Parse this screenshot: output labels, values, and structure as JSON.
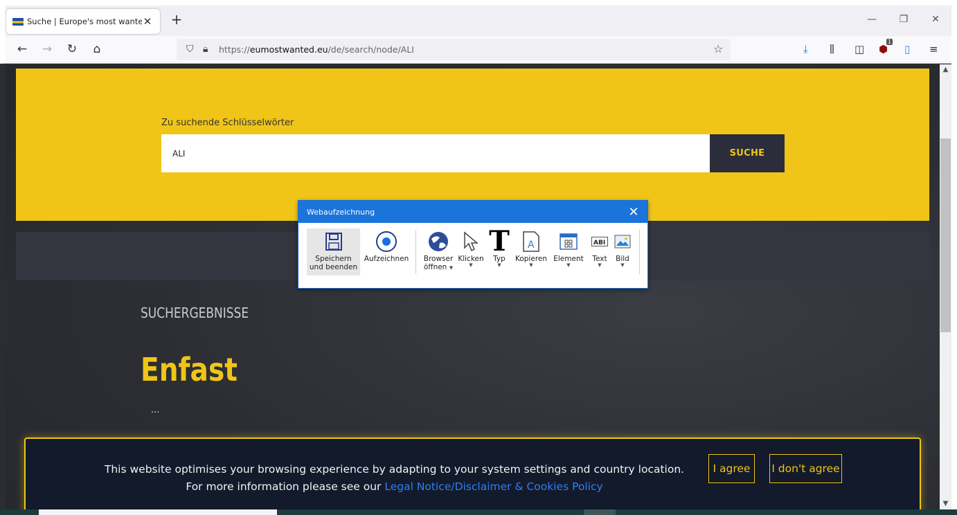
{
  "browser": {
    "tab_title": "Suche | Europe's most wanted",
    "url_scheme": "https://",
    "url_host": "eumostwanted.eu",
    "url_path": "/de/search/node/ALI",
    "ublock_badge": "1"
  },
  "search": {
    "label": "Zu suchende Schlüsselwörter",
    "value": "ALI",
    "button_label": "SUCHE"
  },
  "results": {
    "heading": "SUCHERGEBNISSE",
    "items": [
      {
        "title": "Enfast",
        "snippet": "..."
      }
    ]
  },
  "recorder": {
    "title": "Webaufzeichnung",
    "tools": [
      {
        "line1": "Speichern",
        "line2": "und beenden",
        "icon": "floppy-disk-icon"
      },
      {
        "line1": "Aufzeichnen",
        "line2": "",
        "icon": "record-icon"
      },
      {
        "line1": "Browser",
        "line2": "öffnen",
        "icon": "globe-icon"
      },
      {
        "line1": "Klicken",
        "line2": "",
        "icon": "cursor-icon"
      },
      {
        "line1": "Typ",
        "line2": "",
        "icon": "type-icon"
      },
      {
        "line1": "Kopieren",
        "line2": "",
        "icon": "copy-icon"
      },
      {
        "line1": "Element",
        "line2": "",
        "icon": "element-icon"
      },
      {
        "line1": "Text",
        "line2": "",
        "icon": "text-icon"
      },
      {
        "line1": "Bild",
        "line2": "",
        "icon": "image-icon"
      }
    ]
  },
  "cookie": {
    "text": "This website optimises your browsing experience by adapting to your system settings and country location. For more information please see our",
    "link": "Legal Notice/Disclaimer & Cookies Policy",
    "agree": "I agree",
    "disagree": "I don't agree"
  },
  "colors": {
    "accent_yellow": "#f0c517",
    "dark_navy": "#2b2d3b",
    "recorder_blue": "#1b74d9"
  }
}
